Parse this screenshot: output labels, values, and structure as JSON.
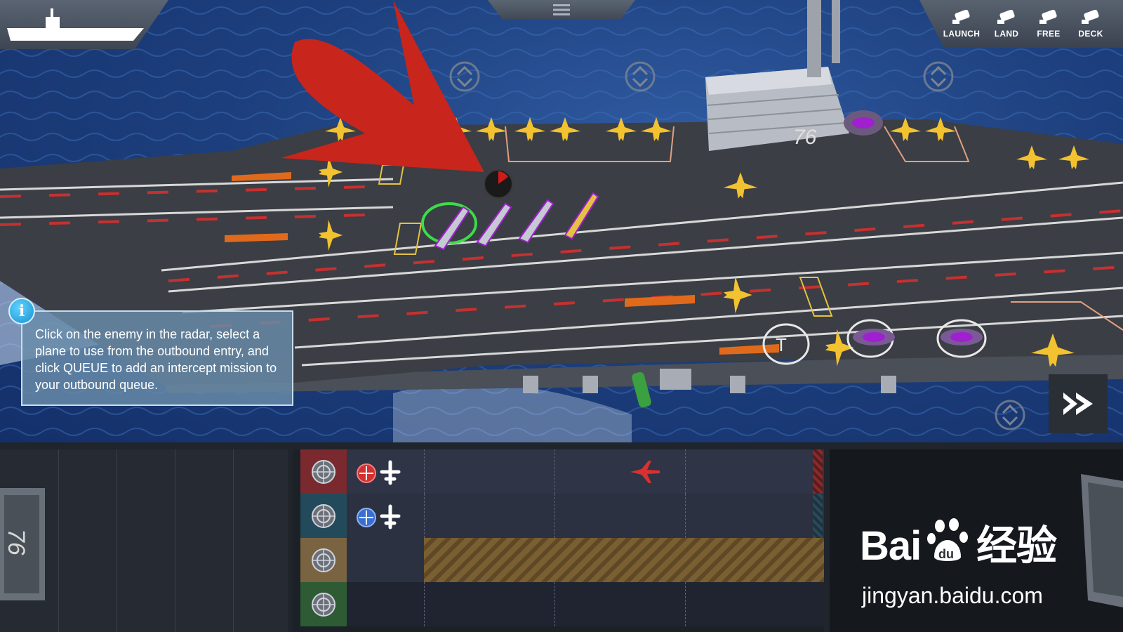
{
  "camera_buttons": [
    {
      "label": "LAUNCH",
      "icon": "camera-icon"
    },
    {
      "label": "LAND",
      "icon": "camera-icon"
    },
    {
      "label": "FREE",
      "icon": "camera-icon"
    },
    {
      "label": "DECK",
      "icon": "camera-icon"
    }
  ],
  "hull_number": "76",
  "tutorial": {
    "icon": "i",
    "text": "Click on the enemy in the radar, select a plane to use from the outbound entry, and click QUEUE to add an intercept mission to your outbound queue."
  },
  "lanes": [
    {
      "name": "enemy-radar",
      "color": "#7a2a2e",
      "marker_color": "#d23030"
    },
    {
      "name": "friendly-radar",
      "color": "#234a5a",
      "marker_color": "#3a6fd0"
    },
    {
      "name": "outbound-queue",
      "color": "#7a6340",
      "marker_color": ""
    },
    {
      "name": "inbound-radar",
      "color": "#2e5a34",
      "marker_color": ""
    }
  ],
  "watermark": {
    "brand": "Bai",
    "brand2": "经验",
    "url": "jingyan.baidu.com"
  },
  "colors": {
    "accent_yellow": "#f2c230",
    "enemy_red": "#d93030",
    "friendly_blue": "#3a6fd0",
    "selection_green": "#3ddc4a",
    "arrow_red": "#c8251c"
  }
}
